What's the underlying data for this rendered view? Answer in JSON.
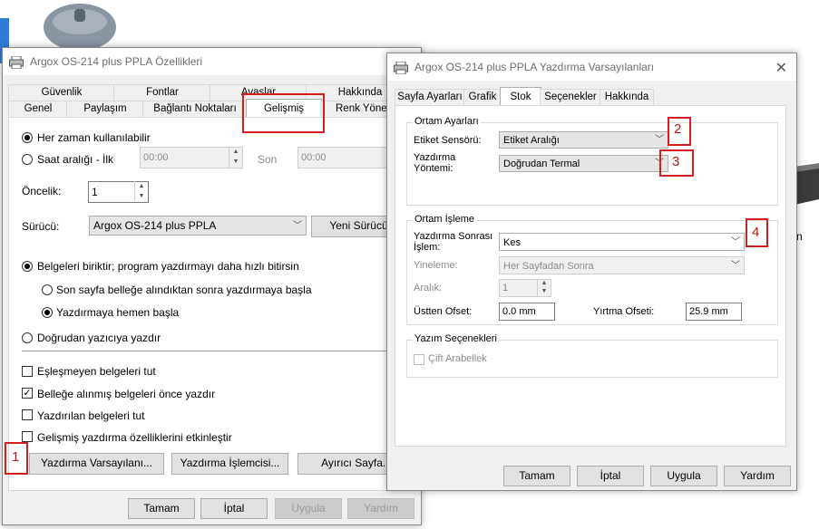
{
  "background": {
    "mouse_color": "#7f8a96",
    "device_color": "#3a3a3a"
  },
  "left_dialog": {
    "title": "Argox OS-214 plus PPLA Özellikleri",
    "tabs_row1": [
      "Güvenlik",
      "Fontlar",
      "Avaslar",
      "Hakkında"
    ],
    "tabs_row2": [
      "Genel",
      "Paylaşım",
      "Bağlantı Noktaları",
      "Gelişmiş",
      "Renk Yöneti"
    ],
    "active_tab": "Gelişmiş",
    "always_available_label": "Her zaman kullanılabilir",
    "time_range_label": "Saat aralığı - İlk",
    "time_start_value": "00:00",
    "time_end_label": "Son",
    "time_end_value": "00:00",
    "priority_label": "Öncelik:",
    "priority_value": "1",
    "driver_label": "Sürücü:",
    "driver_value": "Argox OS-214 plus PPLA",
    "new_driver_button": "Yeni Sürücü...",
    "spool_label": "Belgeleri biriktir; program yazdırmayı daha hızlı bitirsin",
    "spool_after_last_page": "Son sayfa belleğe alındıktan sonra yazdırmaya başla",
    "spool_immediately": "Yazdırmaya hemen başla",
    "print_direct": "Doğrudan yazıcıya yazdır",
    "hold_mismatched": "Eşleşmeyen belgeleri tut",
    "print_spooled_first": "Belleğe alınmış belgeleri önce yazdır",
    "keep_printed": "Yazdırılan belgeleri tut",
    "enable_advanced": "Gelişmiş yazdırma özelliklerini etkinleştir",
    "print_defaults_button": "Yazdırma Varsayılanı...",
    "print_processor_button": "Yazdırma İşlemcisi...",
    "separator_page_button": "Ayırıcı Sayfa...",
    "ok_button": "Tamam",
    "cancel_button": "İptal",
    "apply_button": "Uygula",
    "help_button": "Yardım"
  },
  "right_dialog": {
    "title": "Argox OS-214 plus PPLA Yazdırma Varsayılanları",
    "tabs": [
      "Sayfa Ayarları",
      "Grafik",
      "Stok",
      "Seçenekler",
      "Hakkında"
    ],
    "active_tab": "Stok",
    "media_settings_group": "Ortam Ayarları",
    "label_sensor_label": "Etiket Sensörü:",
    "label_sensor_value": "Etiket Aralığı",
    "print_method_label_line1": "Yazdırma",
    "print_method_label_line2": "Yöntemi:",
    "print_method_value": "Doğrudan Termal",
    "media_handling_group": "Ortam İşleme",
    "post_print_label_line1": "Yazdırma Sonrası",
    "post_print_label_line2": "İşlem:",
    "post_print_value": "Kes",
    "repeat_label": "Yineleme:",
    "repeat_value": "Her Sayfadan Sonra",
    "interval_label": "Aralık:",
    "interval_value": "1",
    "top_offset_label": "Üstten Ofset:",
    "top_offset_value": "0.0 mm",
    "tear_offset_label": "Yırtma Ofseti:",
    "tear_offset_value": "25.9 mm",
    "print_options_group": "Yazım Seçenekleri",
    "double_buffer_label": "Çift Arabellek",
    "ok_button": "Tamam",
    "cancel_button": "İptal",
    "apply_button": "Uygula",
    "help_button": "Yardım"
  },
  "annotations": {
    "n1": "1",
    "n2": "2",
    "n3": "3",
    "n4": "4",
    "color": "#d11f1f"
  }
}
